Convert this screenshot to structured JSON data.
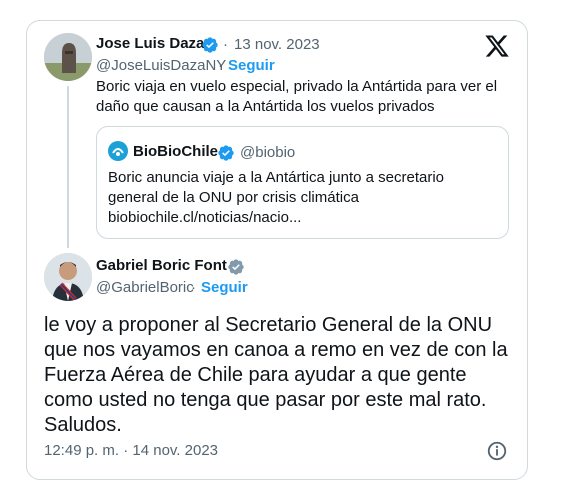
{
  "quoted_tweet": {
    "author_name": "Jose Luis Daza",
    "separator": "·",
    "date": "13 nov. 2023",
    "handle": "@JoseLuisDazaNY",
    "handle_sep": "·",
    "follow": "Seguir",
    "text": "Boric viaja en vuelo especial, privado la Antártida para ver el daño que causan a la Antártida los vuelos privados",
    "embedded": {
      "source_name": "BioBioChile",
      "source_handle": "@biobio",
      "text": "Boric anuncia viaje a la Antártica junto a secretario general de la ONU por crisis climática",
      "link": "biobiochile.cl/noticias/nacio..."
    }
  },
  "main_tweet": {
    "author_name": "Gabriel Boric Font",
    "handle": "@GabrielBoric",
    "handle_sep": "·",
    "follow": "Seguir",
    "text": "le voy a proponer al Secretario General de la ONU que nos vayamos en canoa a remo en vez de con la Fuerza Aérea de Chile para ayudar a que gente como usted no tenga que pasar por este mal rato. Saludos.",
    "timestamp": "12:49 p. m. · 14 nov. 2023"
  },
  "colors": {
    "accent": "#1d9bf0",
    "muted": "#536471",
    "border": "#cfd9de",
    "gray_badge": "#829aab"
  }
}
